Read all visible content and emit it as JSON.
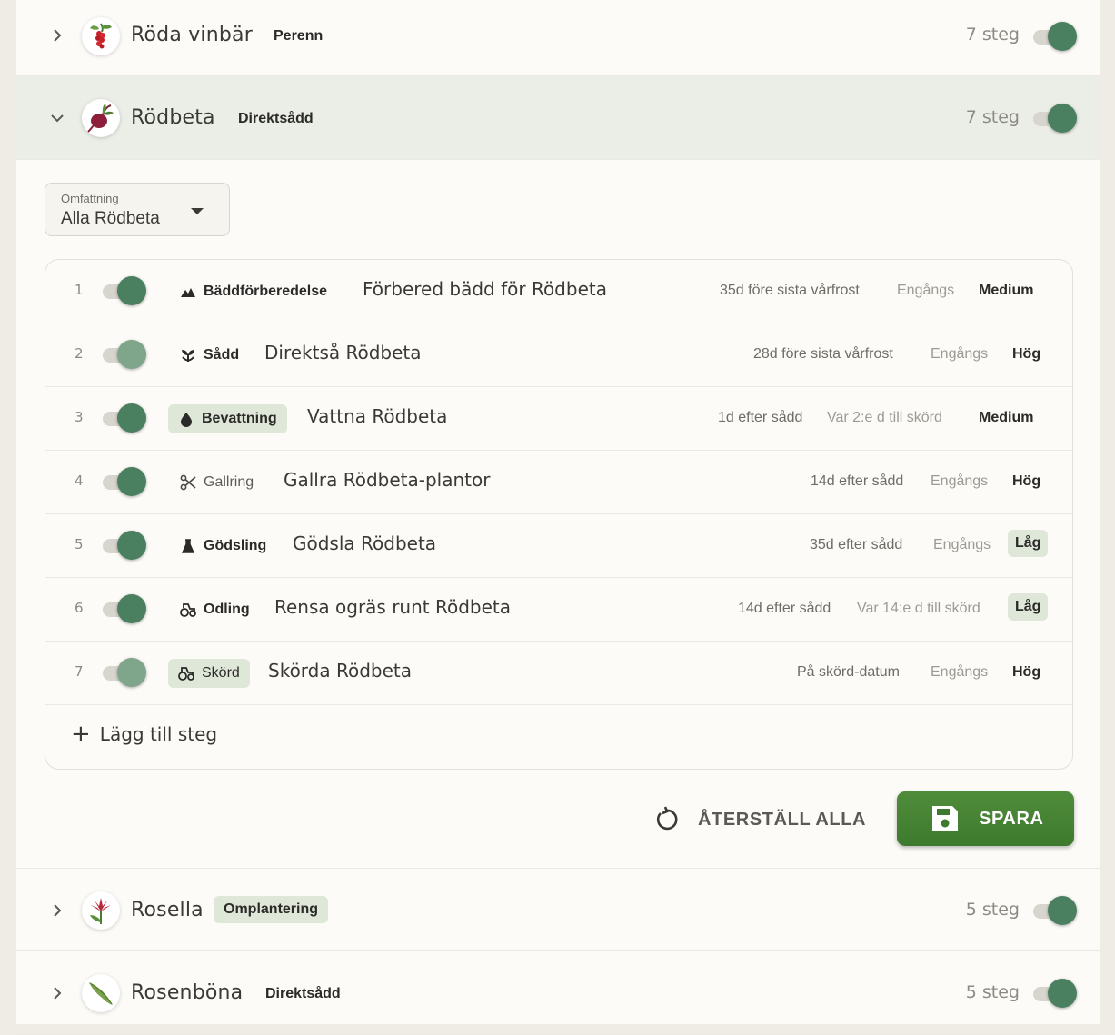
{
  "crops_top": [
    {
      "name": "Röda vinbär",
      "tag": "Perenn",
      "tag_style": "plain",
      "steps": "7 steg",
      "enabled": true,
      "expanded": false,
      "icon": "red-currant-icon"
    },
    {
      "name": "Rödbeta",
      "tag": "Direktsådd",
      "tag_style": "plain",
      "steps": "7 steg",
      "enabled": true,
      "expanded": true,
      "icon": "beetroot-icon"
    }
  ],
  "scope": {
    "label": "Omfattning",
    "value": "Alla Rödbeta"
  },
  "steps": [
    {
      "num": "1",
      "enabled": true,
      "category": "Bäddförberedelse",
      "cat_icon": "mountain-icon",
      "cat_style": "plain",
      "title": "Förbered bädd för Rödbeta",
      "timing": "35d före sista vårfrost",
      "frequency": "Engångs",
      "priority": "Medium",
      "prio_style": "plain"
    },
    {
      "num": "2",
      "enabled": false,
      "category": "Sådd",
      "cat_icon": "sprout-icon",
      "cat_style": "plain",
      "title": "Direktså Rödbeta",
      "timing": "28d före sista vårfrost",
      "frequency": "Engångs",
      "priority": "Hög",
      "prio_style": "plain"
    },
    {
      "num": "3",
      "enabled": true,
      "category": "Bevattning",
      "cat_icon": "water-drop-icon",
      "cat_style": "pill",
      "title": "Vattna Rödbeta",
      "timing": "1d efter sådd",
      "frequency": "Var 2:e d till skörd",
      "priority": "Medium",
      "prio_style": "plain"
    },
    {
      "num": "4",
      "enabled": true,
      "category": "Gallring",
      "cat_icon": "scissors-icon",
      "cat_style": "plain-light",
      "title": "Gallra Rödbeta-plantor",
      "timing": "14d efter sådd",
      "frequency": "Engångs",
      "priority": "Hög",
      "prio_style": "plain"
    },
    {
      "num": "5",
      "enabled": true,
      "category": "Gödsling",
      "cat_icon": "flask-icon",
      "cat_style": "plain",
      "title": "Gödsla Rödbeta",
      "timing": "35d efter sådd",
      "frequency": "Engångs",
      "priority": "Låg",
      "prio_style": "pill"
    },
    {
      "num": "6",
      "enabled": true,
      "category": "Odling",
      "cat_icon": "tractor-icon",
      "cat_style": "plain",
      "title": "Rensa ogräs runt Rödbeta",
      "timing": "14d efter sådd",
      "frequency": "Var 14:e d till skörd",
      "priority": "Låg",
      "prio_style": "pill"
    },
    {
      "num": "7",
      "enabled": false,
      "category": "Skörd",
      "cat_icon": "tractor-icon",
      "cat_style": "pill",
      "title": "Skörda Rödbeta",
      "timing": "På skörd-datum",
      "frequency": "Engångs",
      "priority": "Hög",
      "prio_style": "plain"
    }
  ],
  "add_step_label": "Lägg till steg",
  "actions": {
    "reset_label": "ÅTERSTÄLL ALLA",
    "save_label": "SPARA"
  },
  "crops_bottom": [
    {
      "name": "Rosella",
      "tag": "Omplantering",
      "tag_style": "pill",
      "steps": "5 steg",
      "enabled": true,
      "expanded": false,
      "icon": "rosella-icon"
    },
    {
      "name": "Rosenböna",
      "tag": "Direktsådd",
      "tag_style": "plain",
      "steps": "5 steg",
      "enabled": true,
      "expanded": false,
      "icon": "bean-pod-icon"
    }
  ],
  "colors": {
    "accent": "#4a8060",
    "save": "#3e7a2d",
    "pill": "#dfe8d8",
    "expanded_row": "#eaeee6"
  }
}
